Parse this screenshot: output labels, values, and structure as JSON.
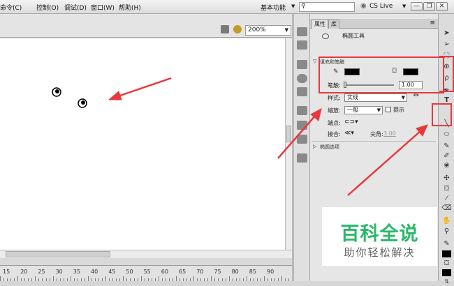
{
  "menubar": {
    "items": [
      "命令(C)",
      "控制(O)",
      "调试(D)",
      "窗口(W)",
      "帮助(H)"
    ],
    "workspace": "基本功能",
    "search_placeholder": "",
    "cs_live": "CS Live",
    "window_buttons": [
      "—",
      "❐",
      "✕"
    ]
  },
  "stage": {
    "zoom": "200%"
  },
  "ruler": {
    "labels": [
      "15",
      "20",
      "25",
      "30",
      "35",
      "40",
      "45",
      "50",
      "55",
      "60",
      "65",
      "70",
      "75",
      "80",
      "85",
      "90"
    ]
  },
  "properties": {
    "tabs": [
      "属性",
      "库"
    ],
    "tool_name": "椭圆工具",
    "fill_stroke_section": "填充和笔触",
    "stroke_label": "笔触:",
    "stroke_value": "1.00",
    "style_label": "样式:",
    "style_value": "实线",
    "scale_label": "缩放:",
    "scale_value": "一般",
    "hint_label": "提示",
    "cap_label": "端点:",
    "join_label": "接合:",
    "miter_label": "尖角:",
    "miter_value": "3.00",
    "ellipse_section": "椭圆选项",
    "stroke_color": "#000000",
    "fill_color": "#000000"
  },
  "watermark": {
    "title": "百科全说",
    "subtitle": "助你轻松解决"
  },
  "colors": {
    "accent_red": "#e8383d",
    "watermark_green": "#29b86a"
  }
}
